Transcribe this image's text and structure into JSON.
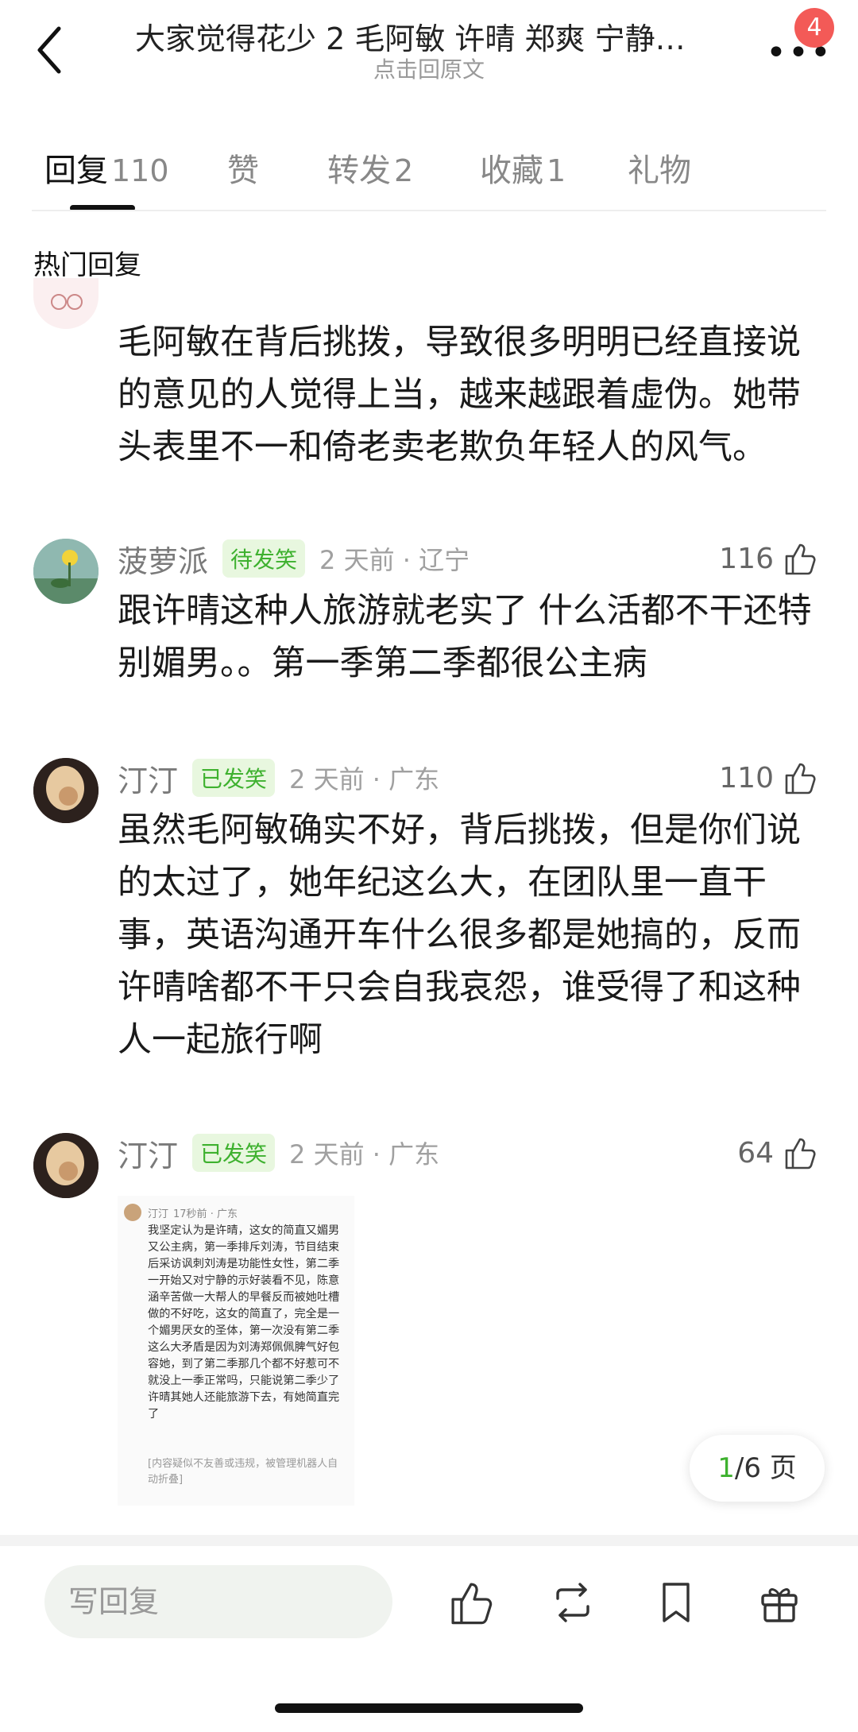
{
  "header": {
    "title": "大家觉得花少 2 毛阿敏 许晴 郑爽 宁静…",
    "subtitle": "点击回原文",
    "badge": "4",
    "icons": {
      "back": "back-arrow-icon",
      "more": "more-dots-icon"
    }
  },
  "tabs": [
    {
      "label": "回复",
      "count": "110",
      "active": true
    },
    {
      "label": "赞",
      "count": ""
    },
    {
      "label": "转发",
      "count": "2"
    },
    {
      "label": "收藏",
      "count": "1"
    },
    {
      "label": "礼物",
      "count": ""
    }
  ],
  "section_title": "热门回复",
  "comments": [
    {
      "text": "毛阿敏在背后挑拨，导致很多明明已经直接说的意见的人觉得上当，越来越跟着虚伪。她带头表里不一和倚老卖老欺负年轻人的风气。"
    },
    {
      "user": "菠萝派",
      "tag": "待发笑",
      "time": "2 天前 · 辽宁",
      "likes": "116",
      "text": "跟许晴这种人旅游就老实了 什么活都不干还特别媚男。。第一季第二季都很公主病"
    },
    {
      "user": "汀汀",
      "tag": "已发笑",
      "time": "2 天前 · 广东",
      "likes": "110",
      "text": "虽然毛阿敏确实不好，背后挑拨，但是你们说的太过了，她年纪这么大，在团队里一直干事，英语沟通开车什么很多都是她搞的，反而许晴啥都不干只会自我哀怨，谁受得了和这种人一起旅行啊"
    },
    {
      "user": "汀汀",
      "tag": "已发笑",
      "time": "2 天前 · 广东",
      "likes": "64",
      "embed": {
        "user": "汀汀",
        "time": "17秒前 · 广东",
        "text": "我坚定认为是许晴，这女的简直又媚男又公主病，第一季排斥刘涛，节目结束后采访讽刺刘涛是功能性女性，第二季一开始又对宁静的示好装看不见，陈意涵辛苦做一大帮人的早餐反而被她吐槽做的不好吃，这女的简直了，完全是一个媚男厌女的圣体，第一次没有第二季这么大矛盾是因为刘涛郑佩佩脾气好包容她，到了第二季那几个都不好惹可不就没上一季正常吗，只能说第二季少了许晴其她人还能旅游下去，有她简直完了",
        "note": "[内容疑似不友善或违规，被管理机器人自动折叠]"
      }
    }
  ],
  "pager": {
    "current": "1",
    "total": "/6 页"
  },
  "bottom_bar": {
    "reply_placeholder": "写回复",
    "icons": [
      "like-icon",
      "repost-icon",
      "bookmark-icon",
      "gift-icon"
    ]
  },
  "colors": {
    "accent_green": "#3eb12f",
    "badge_red": "#f35a57"
  }
}
